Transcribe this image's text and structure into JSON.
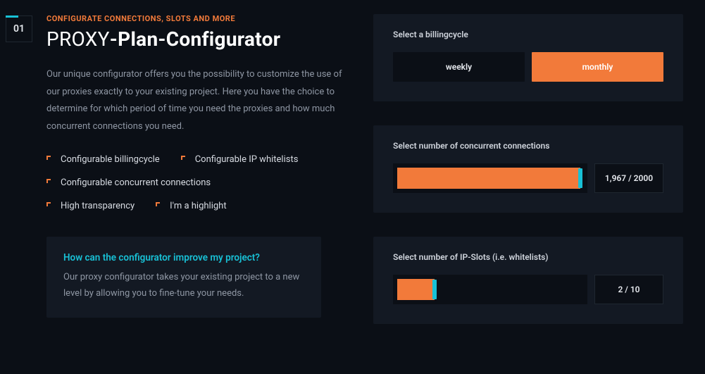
{
  "step": {
    "number": "01",
    "eyebrow": "CONFIGURATE CONNECTIONS, SLOTS AND MORE",
    "title_light": "PROXY",
    "title_bold": "-Plan-Configurator"
  },
  "description": "Our unique configurator offers you the possibility to customize the use of our proxies exactly to your existing project. Here you have the choice to determine for which period of time you need the proxies and how much concurrent connections you need.",
  "features": [
    "Configurable billingcycle",
    "Configurable IP whitelists",
    "Configurable concurrent connections",
    "High transparency",
    "I'm a highlight"
  ],
  "faq": {
    "question": "How can the configurator improve my project?",
    "answer": "Our proxy configurator takes your existing project to a new level by allowing you to fine-tune your needs."
  },
  "billing": {
    "label": "Select a billingcycle",
    "option_a": "weekly",
    "option_b": "monthly"
  },
  "connections": {
    "label": "Select number of concurrent connections",
    "value": 1967,
    "max": 2000,
    "readout": "1,967 / 2000"
  },
  "slots": {
    "label": "Select number of IP-Slots (i.e. whitelists)",
    "value": 2,
    "max": 10,
    "readout": "2 / 10"
  },
  "colors": {
    "accent": "#f27a3a",
    "highlight": "#18c1d6",
    "bg": "#0b0f16",
    "panel": "#131923"
  }
}
